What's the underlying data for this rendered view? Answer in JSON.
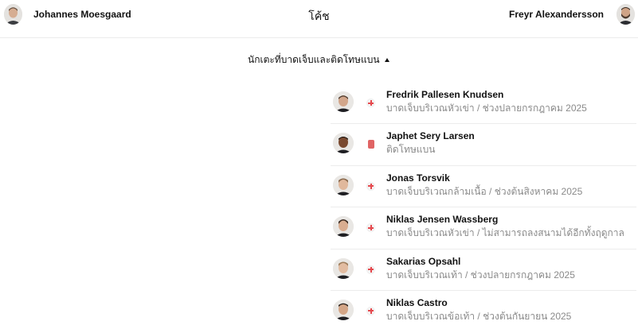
{
  "coaches": {
    "title": "โค้ช",
    "home": {
      "name": "Johannes Moesgaard"
    },
    "away": {
      "name": "Freyr Alexandersson"
    }
  },
  "section": {
    "title": "นักเตะที่บาดเจ็บและติดโทษแบน",
    "expanded": true
  },
  "players": [
    {
      "name": "Fredrik Pallesen Knudsen",
      "detail": "บาดเจ็บบริเวณหัวเข่า / ช่วงปลายกรกฎาคม 2025",
      "status": "injury"
    },
    {
      "name": "Japhet Sery Larsen",
      "detail": "ติดโทษแบน",
      "status": "red-card"
    },
    {
      "name": "Jonas Torsvik",
      "detail": "บาดเจ็บบริเวณกล้ามเนื้อ / ช่วงต้นสิงหาคม 2025",
      "status": "injury"
    },
    {
      "name": "Niklas Jensen Wassberg",
      "detail": "บาดเจ็บบริเวณหัวเข่า / ไม่สามารถลงสนามได้อีกทั้งฤดูกาล",
      "status": "injury"
    },
    {
      "name": "Sakarias Opsahl",
      "detail": "บาดเจ็บบริเวณเท้า / ช่วงปลายกรกฎาคม 2025",
      "status": "injury"
    },
    {
      "name": "Niklas Castro",
      "detail": "บาดเจ็บบริเวณข้อเท้า / ช่วงต้นกันยายน 2025",
      "status": "injury"
    }
  ],
  "colors": {
    "injury": "#e5484d",
    "red_card": "#e06464",
    "muted_text": "#8a8a8a"
  }
}
